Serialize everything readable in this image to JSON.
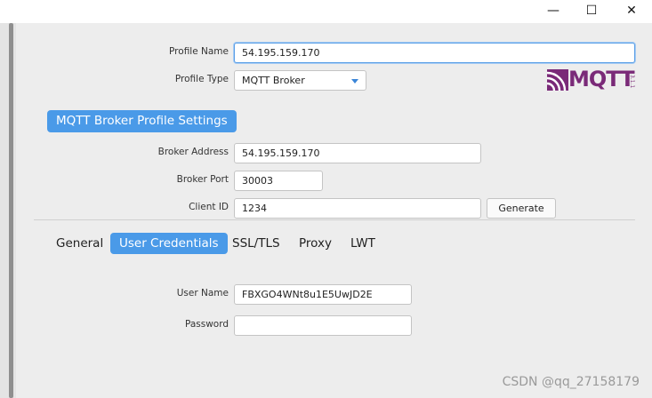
{
  "window": {
    "minimize_glyph": "—",
    "maximize_glyph": "☐",
    "close_glyph": "✕"
  },
  "profile": {
    "name_label": "Profile Name",
    "name_value": "54.195.159.170",
    "type_label": "Profile Type",
    "type_value": "MQTT Broker"
  },
  "logo": {
    "text": "MQTT",
    "small_text": "3.1.1"
  },
  "section_title": "MQTT Broker Profile Settings",
  "broker": {
    "address_label": "Broker Address",
    "address_value": "54.195.159.170",
    "port_label": "Broker Port",
    "port_value": "30003",
    "client_id_label": "Client ID",
    "client_id_value": "1234",
    "generate_label": "Generate"
  },
  "tabs": [
    {
      "label": "General",
      "active": false
    },
    {
      "label": "User Credentials",
      "active": true
    },
    {
      "label": "SSL/TLS",
      "active": false
    },
    {
      "label": "Proxy",
      "active": false
    },
    {
      "label": "LWT",
      "active": false
    }
  ],
  "credentials": {
    "username_label": "User Name",
    "username_value": "FBXGO4WNt8u1E5UwJD2E",
    "password_label": "Password",
    "password_value": ""
  },
  "watermark": "CSDN @qq_27158179",
  "colors": {
    "accent": "#4a9ae8",
    "focus": "#5b9fe6",
    "logo": "#7a2a78"
  }
}
